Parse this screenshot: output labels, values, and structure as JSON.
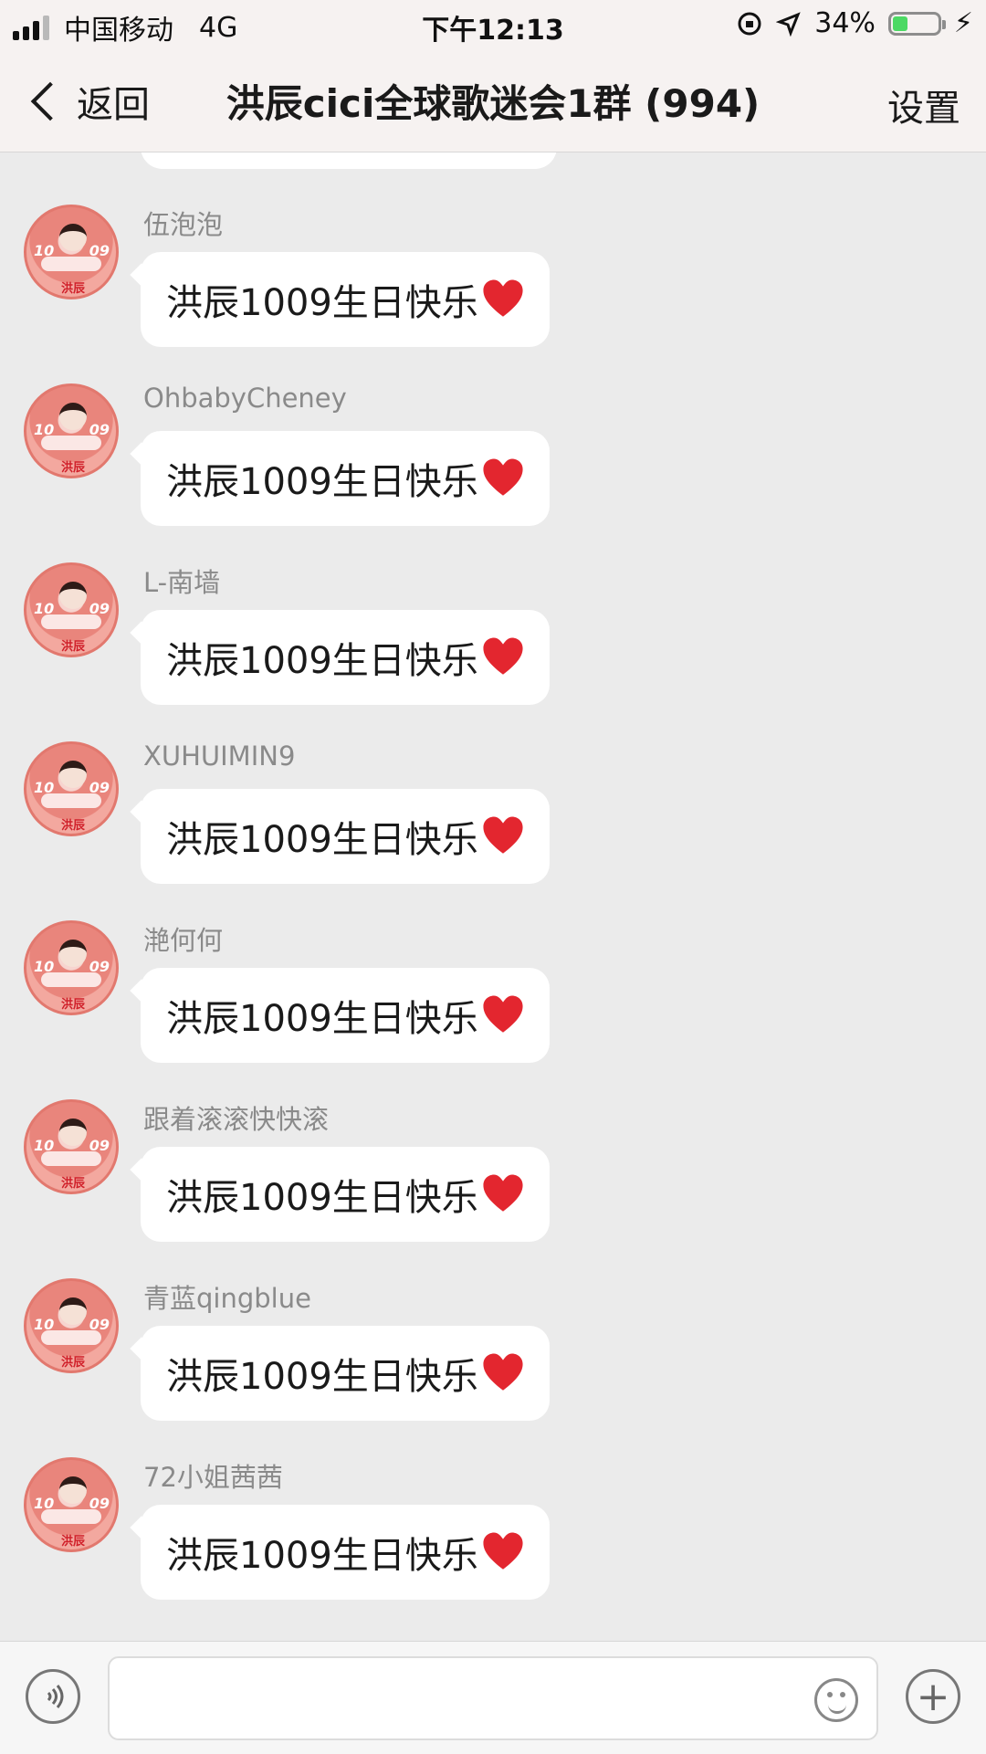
{
  "status_bar": {
    "carrier": "中国移动",
    "network": "4G",
    "time": "下午12:13",
    "battery": "34%",
    "battery_level": 0.34
  },
  "nav": {
    "back": "返回",
    "title": "洪辰cici全球歌迷会1群 (994)",
    "settings": "设置"
  },
  "messages": [
    {
      "name": "伍泡泡",
      "text": "洪辰1009生日快乐"
    },
    {
      "name": "OhbabyCheney",
      "text": "洪辰1009生日快乐"
    },
    {
      "name": "L-南墙",
      "text": "洪辰1009生日快乐"
    },
    {
      "name": "XUHUIMIN9",
      "text": "洪辰1009生日快乐"
    },
    {
      "name": "滟何何",
      "text": "洪辰1009生日快乐"
    },
    {
      "name": "跟着滚滚快快滚",
      "text": "洪辰1009生日快乐"
    },
    {
      "name": "青蓝qingblue",
      "text": "洪辰1009生日快乐"
    },
    {
      "name": "72小姐茜茜",
      "text": "洪辰1009生日快乐"
    }
  ],
  "avatar_text": {
    "left": "10",
    "right": "09",
    "tag": "洪辰"
  },
  "icons": {
    "voice": "voice-icon",
    "emoji": "emoji-icon",
    "plus": "plus-icon",
    "heart": "red-heart-icon"
  }
}
